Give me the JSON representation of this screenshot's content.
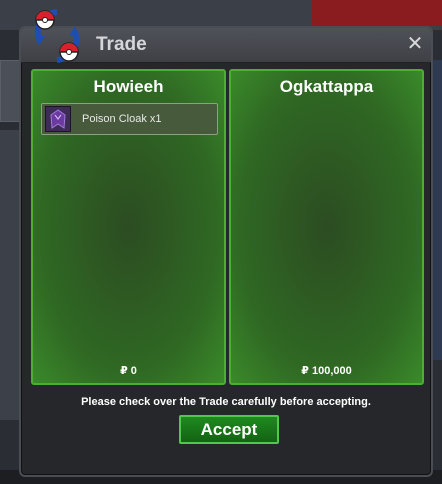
{
  "window": {
    "title": "Trade",
    "close_glyph": "✕"
  },
  "trade": {
    "left": {
      "name": "Howieeh",
      "items": [
        {
          "label": "Poison Cloak x1",
          "icon": "poison-cloak-icon"
        }
      ],
      "money": "₽ 0"
    },
    "right": {
      "name": "Ogkattappa",
      "items": [],
      "money": "₽ 100,000"
    }
  },
  "notice": "Please check over the Trade carefully before accepting.",
  "accept_label": "Accept",
  "colors": {
    "panel_green": "#2f6823",
    "panel_border": "#4caf2f",
    "button_green": "#1f8a1f"
  }
}
